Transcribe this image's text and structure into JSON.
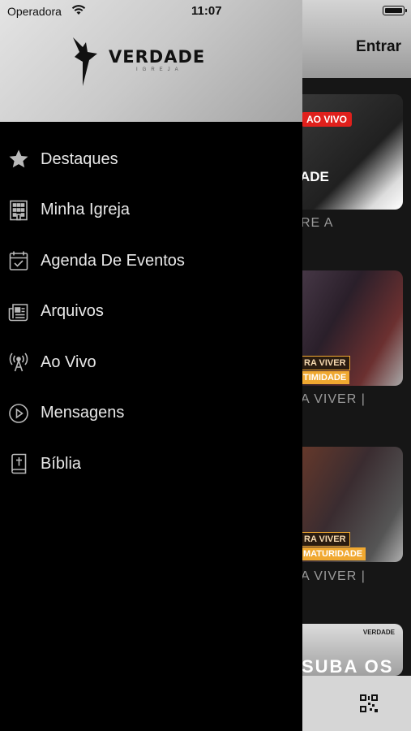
{
  "status_bar": {
    "carrier": "Operadora",
    "time": "11:07"
  },
  "header": {
    "login_label": "Entrar"
  },
  "drawer": {
    "logo_text": "VERDADE",
    "logo_subtitle": "IGREJA",
    "items": [
      {
        "label": "Destaques",
        "icon": "star-icon"
      },
      {
        "label": "Minha Igreja",
        "icon": "building-icon"
      },
      {
        "label": "Agenda De Eventos",
        "icon": "calendar-check-icon"
      },
      {
        "label": "Arquivos",
        "icon": "newspaper-icon"
      },
      {
        "label": "Ao Vivo",
        "icon": "broadcast-tower-icon"
      },
      {
        "label": "Mensagens",
        "icon": "play-circle-icon"
      },
      {
        "label": "Bíblia",
        "icon": "bible-icon"
      }
    ]
  },
  "background_feed": {
    "cards": [
      {
        "badge": "AO VIVO",
        "title_fragment": "ADE",
        "caption": "RE A"
      },
      {
        "strip_top": "RA VIVER",
        "strip_bottom": "TIMIDADE",
        "caption": "A VIVER |"
      },
      {
        "strip_top": "RA VIVER",
        "strip_bottom": "MATURIDADE",
        "caption": "A VIVER |"
      },
      {
        "title_fragment": "SUBA OS",
        "logo": "VERDADE"
      }
    ]
  },
  "colors": {
    "accent_live": "#e0201c",
    "accent_orange": "#f0a830",
    "drawer_bg": "#000000",
    "menu_text": "#e8e8e8"
  }
}
